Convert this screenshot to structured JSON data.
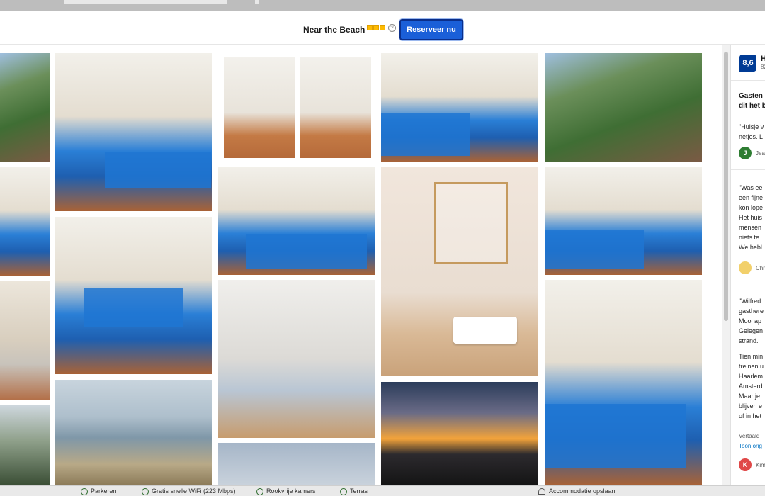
{
  "header": {
    "hotel_name": "Near the Beach",
    "star_count": 3,
    "reserve_label": "Reserveer nu",
    "info_symbol": "?"
  },
  "gallery": {
    "photos": [
      {
        "subject": "garden"
      },
      {
        "subject": "bedroom"
      },
      {
        "subject": "kitchen"
      },
      {
        "subject": "trees"
      },
      {
        "subject": "bedroom"
      },
      {
        "subject": "bedroom"
      },
      {
        "subject": "beach"
      },
      {
        "subject": "bathroom"
      },
      {
        "subject": "bathroom"
      },
      {
        "subject": "bedroom"
      },
      {
        "subject": "sailboat"
      },
      {
        "subject": "sky"
      },
      {
        "subject": "bedroom"
      },
      {
        "subject": "sink"
      },
      {
        "subject": "sunset"
      },
      {
        "subject": "garden"
      },
      {
        "subject": "bedroom"
      },
      {
        "subject": "bedroom"
      }
    ]
  },
  "sidebar": {
    "score": "8,6",
    "score_word": "H",
    "score_count": "82",
    "heading_line1": "Gasten ",
    "heading_line2": "dit het b",
    "review1_line1": "\"Huisje v",
    "review1_line2": "netjes. L",
    "review1_avatar": "J",
    "review1_name": "Jea",
    "review1_avatar_color": "#2e7d32",
    "review2_lines": [
      "\"Was ee",
      "een fijne",
      "kon lope",
      "Het huis",
      "mensen",
      "niets te",
      "We hebl"
    ],
    "review2_name": "Chr",
    "review2_avatar_color": "#f2d06b",
    "review3_lines": [
      "\"Wilfred",
      "gasthere",
      "Mooi ap",
      "Gelegen",
      "strand.",
      "Tien min",
      "treinen u",
      "Haarlem",
      "Amsterd",
      "Maar je",
      "blijven e",
      "of in het"
    ],
    "translated_label": "Vertaald",
    "show_original": "Toon orig",
    "review3_avatar": "K",
    "review3_name": "Kim",
    "review3_avatar_color": "#e04848"
  },
  "bottom_bar": {
    "parking": "Parkeren",
    "wifi": "Gratis snelle WiFi (223 Mbps)",
    "nonsmoking": "Rookvrije kamers",
    "terrace": "Terras",
    "save": "Accommodatie opslaan"
  }
}
